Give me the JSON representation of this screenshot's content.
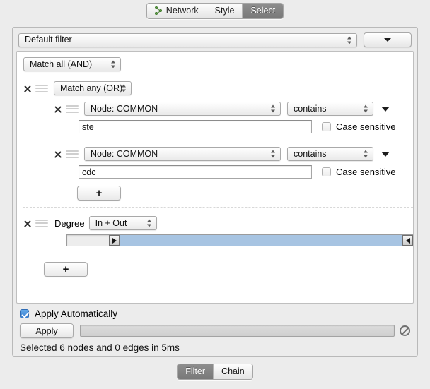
{
  "top_tabs": [
    {
      "label": "Network",
      "icon": "network-graph-icon",
      "active": false
    },
    {
      "label": "Style",
      "icon": "",
      "active": false
    },
    {
      "label": "Select",
      "icon": "",
      "active": true
    }
  ],
  "filter_header": {
    "selected_filter": "Default filter",
    "menu_button_icon": "chevron-down-icon"
  },
  "match_all": {
    "value": "Match all (AND)"
  },
  "group": {
    "value": "Match any (OR)",
    "delete_icon": "close-icon",
    "drag_icon": "drag-handle-icon"
  },
  "conditions": [
    {
      "attribute": "Node: COMMON",
      "operator": "contains",
      "value": "ste",
      "case_sensitive_label": "Case sensitive",
      "case_sensitive_checked": false,
      "expand_icon": "caret-down-icon"
    },
    {
      "attribute": "Node: COMMON",
      "operator": "contains",
      "value": "cdc",
      "case_sensitive_label": "Case sensitive",
      "case_sensitive_checked": false,
      "expand_icon": "caret-down-icon"
    }
  ],
  "add_condition_button": {
    "label": "+"
  },
  "degree": {
    "label": "Degree",
    "value": "In + Out",
    "slider": {
      "low_handle_pct": 12,
      "high_handle_pct": 100
    }
  },
  "add_filter_button": {
    "label": "+"
  },
  "footer": {
    "apply_automatically_label": "Apply Automatically",
    "apply_automatically_checked": true,
    "apply_button_label": "Apply",
    "cancel_icon": "cancel-circle-slash-icon",
    "status": "Selected 6 nodes and 0 edges in 5ms"
  },
  "bottom_tabs": [
    {
      "label": "Filter",
      "active": true
    },
    {
      "label": "Chain",
      "active": false
    }
  ],
  "colors": {
    "window_bg": "#ececec",
    "panel_bg": "#ffffff",
    "slider_fill": "#a7c4e2",
    "checkbox_accent": "#3a7fd0",
    "active_tab_bg": "#7f7f7f",
    "network_icon_green": "#6aa84f"
  }
}
